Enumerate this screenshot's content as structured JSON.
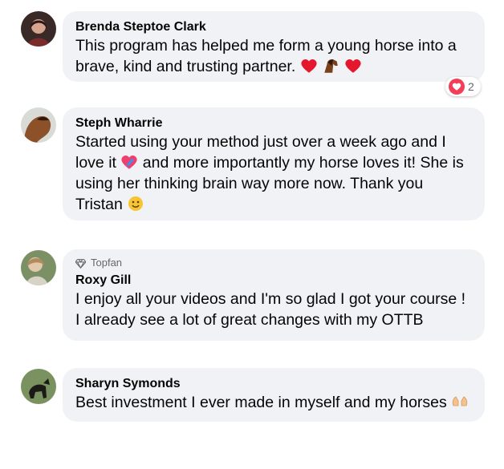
{
  "comments": [
    {
      "author": "Brenda Steptoe Clark",
      "text": "This program has helped me form a young horse into a brave, kind and trusting partner.",
      "reaction_count": "2",
      "reaction_icon": "heart-icon"
    },
    {
      "author": "Steph Wharrie",
      "text": "Started using your method just over a week ago and I love it",
      "text2": "and more importantly my horse loves it! She is using her thinking brain way more now. Thank you Tristan"
    },
    {
      "badge": "Topfan",
      "badge_icon": "diamond-icon",
      "author": "Roxy Gill",
      "text": "I enjoy all your videos and I'm so glad I got your course ! I already see a lot of great changes with my OTTB"
    },
    {
      "author": "Sharyn Symonds",
      "text": "Best investment I ever made in myself and my horses"
    }
  ],
  "colors": {
    "bubble": "#f0f2f5",
    "heart": "#f33e58"
  }
}
